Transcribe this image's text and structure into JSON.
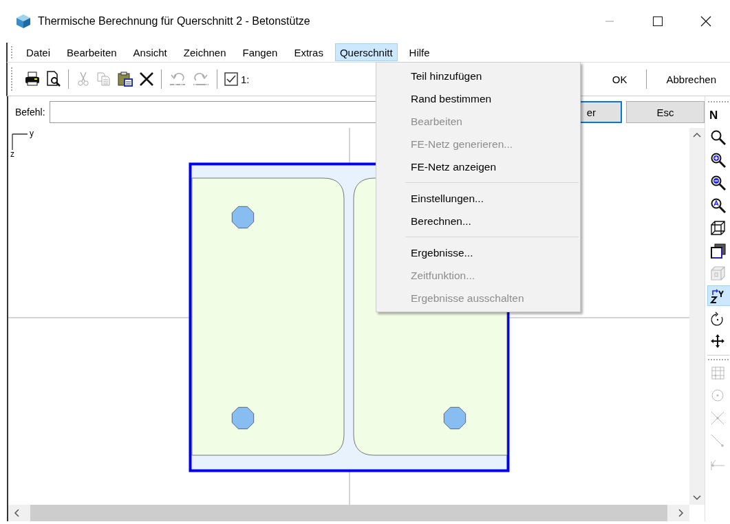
{
  "window": {
    "title": "Thermische Berechnung für Querschnitt 2 - Betonstütze"
  },
  "menu_bar": [
    {
      "label": "Datei",
      "selected": false
    },
    {
      "label": "Bearbeiten",
      "selected": false
    },
    {
      "label": "Ansicht",
      "selected": false
    },
    {
      "label": "Zeichnen",
      "selected": false
    },
    {
      "label": "Fangen",
      "selected": false
    },
    {
      "label": "Extras",
      "selected": false
    },
    {
      "label": "Querschnitt",
      "selected": true
    },
    {
      "label": "Hilfe",
      "selected": false
    }
  ],
  "toolbar": [
    {
      "kind": "button",
      "disabled": false
    },
    {
      "kind": "button",
      "disabled": false
    },
    {
      "kind": "separator"
    },
    {
      "kind": "button",
      "disabled": true
    },
    {
      "kind": "button",
      "disabled": true
    },
    {
      "kind": "button",
      "disabled": false
    },
    {
      "kind": "button",
      "disabled": false
    },
    {
      "kind": "separator"
    },
    {
      "kind": "button",
      "disabled": true
    },
    {
      "kind": "button",
      "disabled": true
    },
    {
      "kind": "separator"
    },
    {
      "kind": "checkbox",
      "checked": true,
      "label": "1:"
    }
  ],
  "dialog_buttons": [
    "OK",
    "Abbrechen"
  ],
  "command": {
    "label": "Befehl:",
    "buttons": [
      {
        "label": "er",
        "focused": true
      },
      {
        "label": "Esc",
        "focused": false
      }
    ]
  },
  "canvas": {
    "axis_labels": [
      "y",
      "z"
    ]
  },
  "side_toolbar": {
    "label": "N",
    "tools": [
      {
        "selected": false,
        "disabled": false
      },
      {
        "selected": false,
        "disabled": false
      },
      {
        "selected": false,
        "disabled": false
      },
      {
        "selected": false,
        "disabled": false
      },
      {
        "selected": false,
        "disabled": false
      },
      {
        "selected": false,
        "disabled": false
      },
      {
        "selected": false,
        "disabled": true
      },
      {
        "selected": true,
        "disabled": false
      },
      {
        "selected": false,
        "disabled": false
      },
      {
        "selected": false,
        "disabled": false
      },
      {
        "selected": false,
        "disabled": true
      },
      {
        "selected": false,
        "disabled": true
      },
      {
        "selected": false,
        "disabled": true
      },
      {
        "selected": false,
        "disabled": true
      },
      {
        "selected": false,
        "disabled": true
      }
    ]
  },
  "dropdown": {
    "items": [
      {
        "kind": "item",
        "label": "Teil hinzufügen",
        "disabled": false
      },
      {
        "kind": "item",
        "label": "Rand bestimmen",
        "disabled": false
      },
      {
        "kind": "item",
        "label": "Bearbeiten",
        "disabled": true
      },
      {
        "kind": "item",
        "label": "FE-Netz generieren...",
        "disabled": true
      },
      {
        "kind": "item",
        "label": "FE-Netz anzeigen",
        "disabled": false
      },
      {
        "kind": "separator"
      },
      {
        "kind": "item",
        "label": "Einstellungen...",
        "disabled": false
      },
      {
        "kind": "item",
        "label": "Berechnen...",
        "disabled": false
      },
      {
        "kind": "separator"
      },
      {
        "kind": "item",
        "label": "Ergebnisse...",
        "disabled": false
      },
      {
        "kind": "item",
        "label": "Zeitfunktion...",
        "disabled": true
      },
      {
        "kind": "item",
        "label": "Ergebnisse ausschalten",
        "disabled": true
      }
    ]
  }
}
